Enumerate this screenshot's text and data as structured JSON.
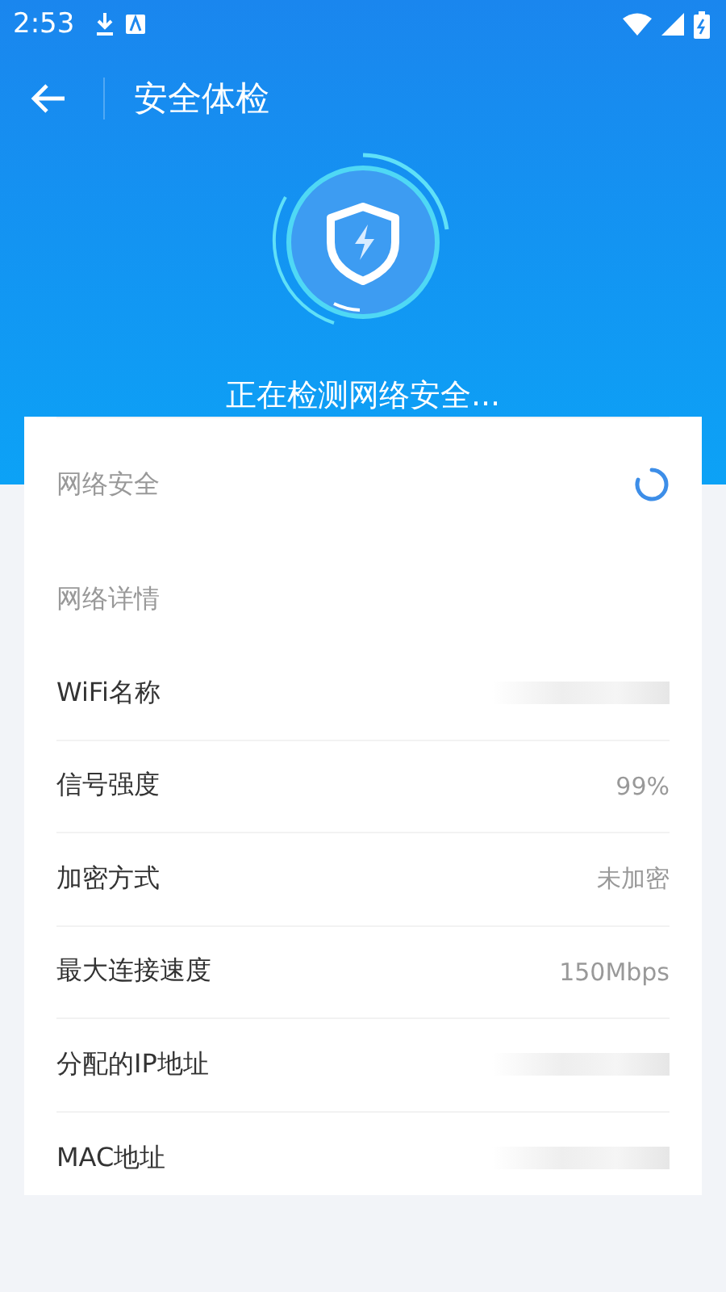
{
  "status_bar": {
    "time": "2:53"
  },
  "header": {
    "title": "安全体检"
  },
  "scan": {
    "message": "正在检测网络安全..."
  },
  "checks": [
    {
      "label": "网络安全",
      "loading": true
    }
  ],
  "details": {
    "title": "网络详情",
    "rows": [
      {
        "label": "WiFi名称",
        "kind": "hidden"
      },
      {
        "label": "信号强度",
        "kind": "text",
        "value": "99%"
      },
      {
        "label": "加密方式",
        "kind": "text",
        "value": "未加密"
      },
      {
        "label": "最大连接速度",
        "kind": "text",
        "value": "150Mbps"
      },
      {
        "label": "分配的IP地址",
        "kind": "hidden"
      },
      {
        "label": "MAC地址",
        "kind": "hidden"
      }
    ]
  }
}
